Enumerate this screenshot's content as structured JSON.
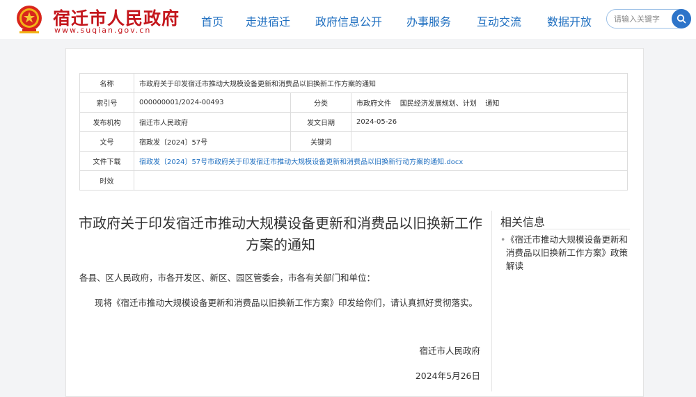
{
  "header": {
    "site_title": "宿迁市人民政府",
    "site_url": "www.suqian.gov.cn",
    "search_placeholder": "请输入关键字"
  },
  "nav": [
    "首页",
    "走进宿迁",
    "政府信息公开",
    "办事服务",
    "互动交流",
    "数据开放"
  ],
  "meta": {
    "name_label": "名称",
    "name_value": "市政府关于印发宿迁市推动大规模设备更新和消费品以旧换新工作方案的通知",
    "index_label": "索引号",
    "index_value": "000000001/2024-00493",
    "category_label": "分类",
    "category_value": "市政府文件    国民经济发展规划、计划    通知",
    "org_label": "发布机构",
    "org_value": "宿迁市人民政府",
    "date_label": "发文日期",
    "date_value": "2024-05-26",
    "docno_label": "文号",
    "docno_value": "宿政发〔2024〕57号",
    "keyword_label": "关键词",
    "keyword_value": "",
    "download_label": "文件下载",
    "download_value": "宿政发〔2024〕57号市政府关于印发宿迁市推动大规模设备更新和消费品以旧换新行动方案的通知.docx",
    "validity_label": "时效",
    "validity_value": ""
  },
  "article": {
    "title": "市政府关于印发宿迁市推动大规模设备更新和消费品以旧换新工作方案的通知",
    "salutation": "各县、区人民政府，市各开发区、新区、园区管委会，市各有关部门和单位：",
    "body": "现将《宿迁市推动大规模设备更新和消费品以旧换新工作方案》印发给你们，请认真抓好贯彻落实。",
    "signature": "宿迁市人民政府",
    "date": "2024年5月26日"
  },
  "sidebar": {
    "title": "相关信息",
    "links": [
      "《宿迁市推动大规模设备更新和消费品以旧换新工作方案》政策解读"
    ]
  }
}
